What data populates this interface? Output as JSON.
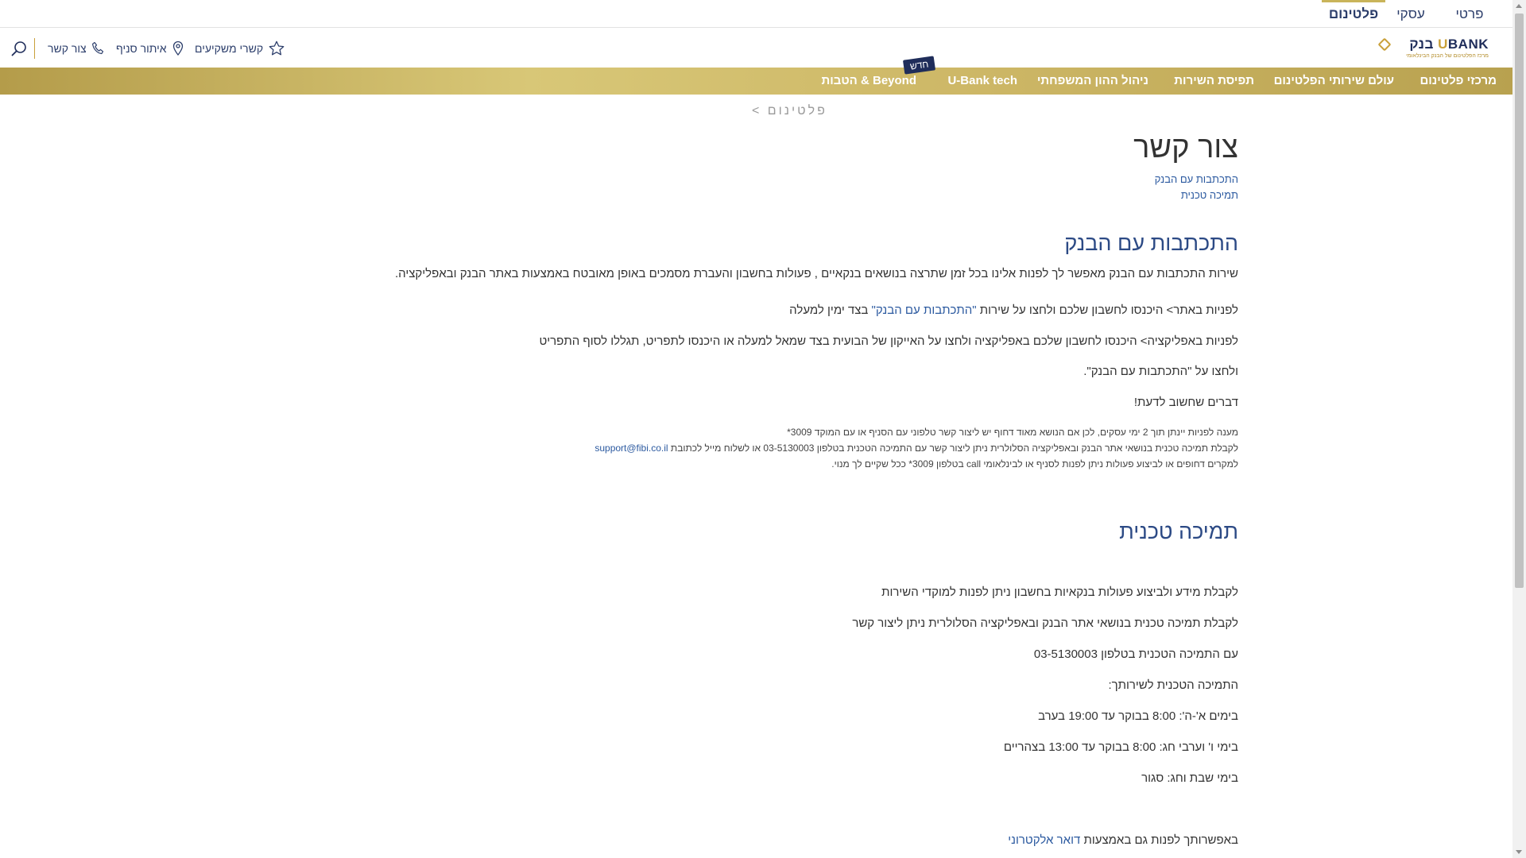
{
  "segments": {
    "private": "פרטי",
    "business": "עסקי",
    "platinum": "פלטינום"
  },
  "logo": {
    "brand": "BANK בנק",
    "u_letter": "U",
    "tagline": "מרכז הפלטינום של הבנק הבינלאומי"
  },
  "utility": {
    "favorites": "קשרי משקיעים",
    "branch_locator": "איתור סניף",
    "contact": "צור קשר"
  },
  "nav": {
    "items": [
      "מרכזי פלטינום",
      "עולם שירותי הפלטינום",
      "תפיסת השירות",
      "ניהול ההון המשפחתי",
      "U-Bank tech",
      "Beyond & הטבות"
    ],
    "new_badge": "חדש"
  },
  "breadcrumb": "פלטינום >",
  "page": {
    "title": "צור קשר",
    "anchors": [
      "התכתבות עם הבנק",
      "תמיכה טכנית"
    ]
  },
  "section1": {
    "title": "התכתבות עם הבנק",
    "p1": "שירות התכתבות עם הבנק מאפשר  לך לפנות אלינו בכל זמן שתרצה בנושאים בנקאיים , פעולות בחשבון והעברת מסמכים באופן מאובטח באמצעות באתר הבנק ובאפליקציה.",
    "p2_before": "לפניות באתר> היכנסו לחשבון שלכם ולחצו על שירות ",
    "p2_link": "\"התכתבות עם הבנק\"",
    "p2_after": " בצד ימין למעלה",
    "p3": " לפניות באפליקציה> היכנסו לחשבון שלכם באפליקציה ולחצו על האייקון של הבועית בצד שמאל למעלה או היכנסו לתפריט, תגללו לסוף התפריט",
    "p4": "ולחצו על \"התכתבות עם הבנק\".",
    "p5": "דברים שחשוב לדעת!",
    "note1": "מענה לפניות יינתן תוך 2 ימי עסקים, לכן אם הנושא מאוד דחוף יש ליצור קשר טלפוני עם הסניף או עם המוקד 3009*",
    "note2_text": "לקבלת תמיכה טכנית בנושאי אתר הבנק ובאפליקציה הסלולרית ניתן ליצור קשר עם התמיכה הטכנית בטלפון 03-5130003 או לשלוח מייל לכתובת ",
    "note2_email": "support@fibi.co.il",
    "note3": "למקרים דחופים או לביצוע פעולות ניתן לפנות לסניף או לבינלאומי call בטלפון 3009* ככל שקיים לך מנוי."
  },
  "section2": {
    "title": "תמיכה טכנית",
    "p1": "לקבלת מידע ולביצוע פעולות בנקאיות בחשבון ניתן לפנות למוקדי השירות",
    "p2": "לקבלת תמיכה טכנית בנושאי אתר הבנק ובאפליקציה הסלולרית ניתן ליצור קשר",
    "p3": "עם התמיכה הטכנית בטלפון 03-5130003",
    "p4": "התמיכה הטכנית לשירותך:",
    "p5": "בימים א'-ה': 8:00 בבוקר עד 19:00 בערב",
    "p6": "בימי ו' וערבי חג: 8:00 בבוקר עד 13:00 בצהריים",
    "p7": "בימי שבת וחג: סגור",
    "p8_before": "באפשרותך לפנות גם באמצעות ",
    "p8_link": "דואר אלקטרוני"
  },
  "colors": {
    "gold": "#c9b45a",
    "navy": "#1f2d5a",
    "link": "#2c5aa0"
  }
}
